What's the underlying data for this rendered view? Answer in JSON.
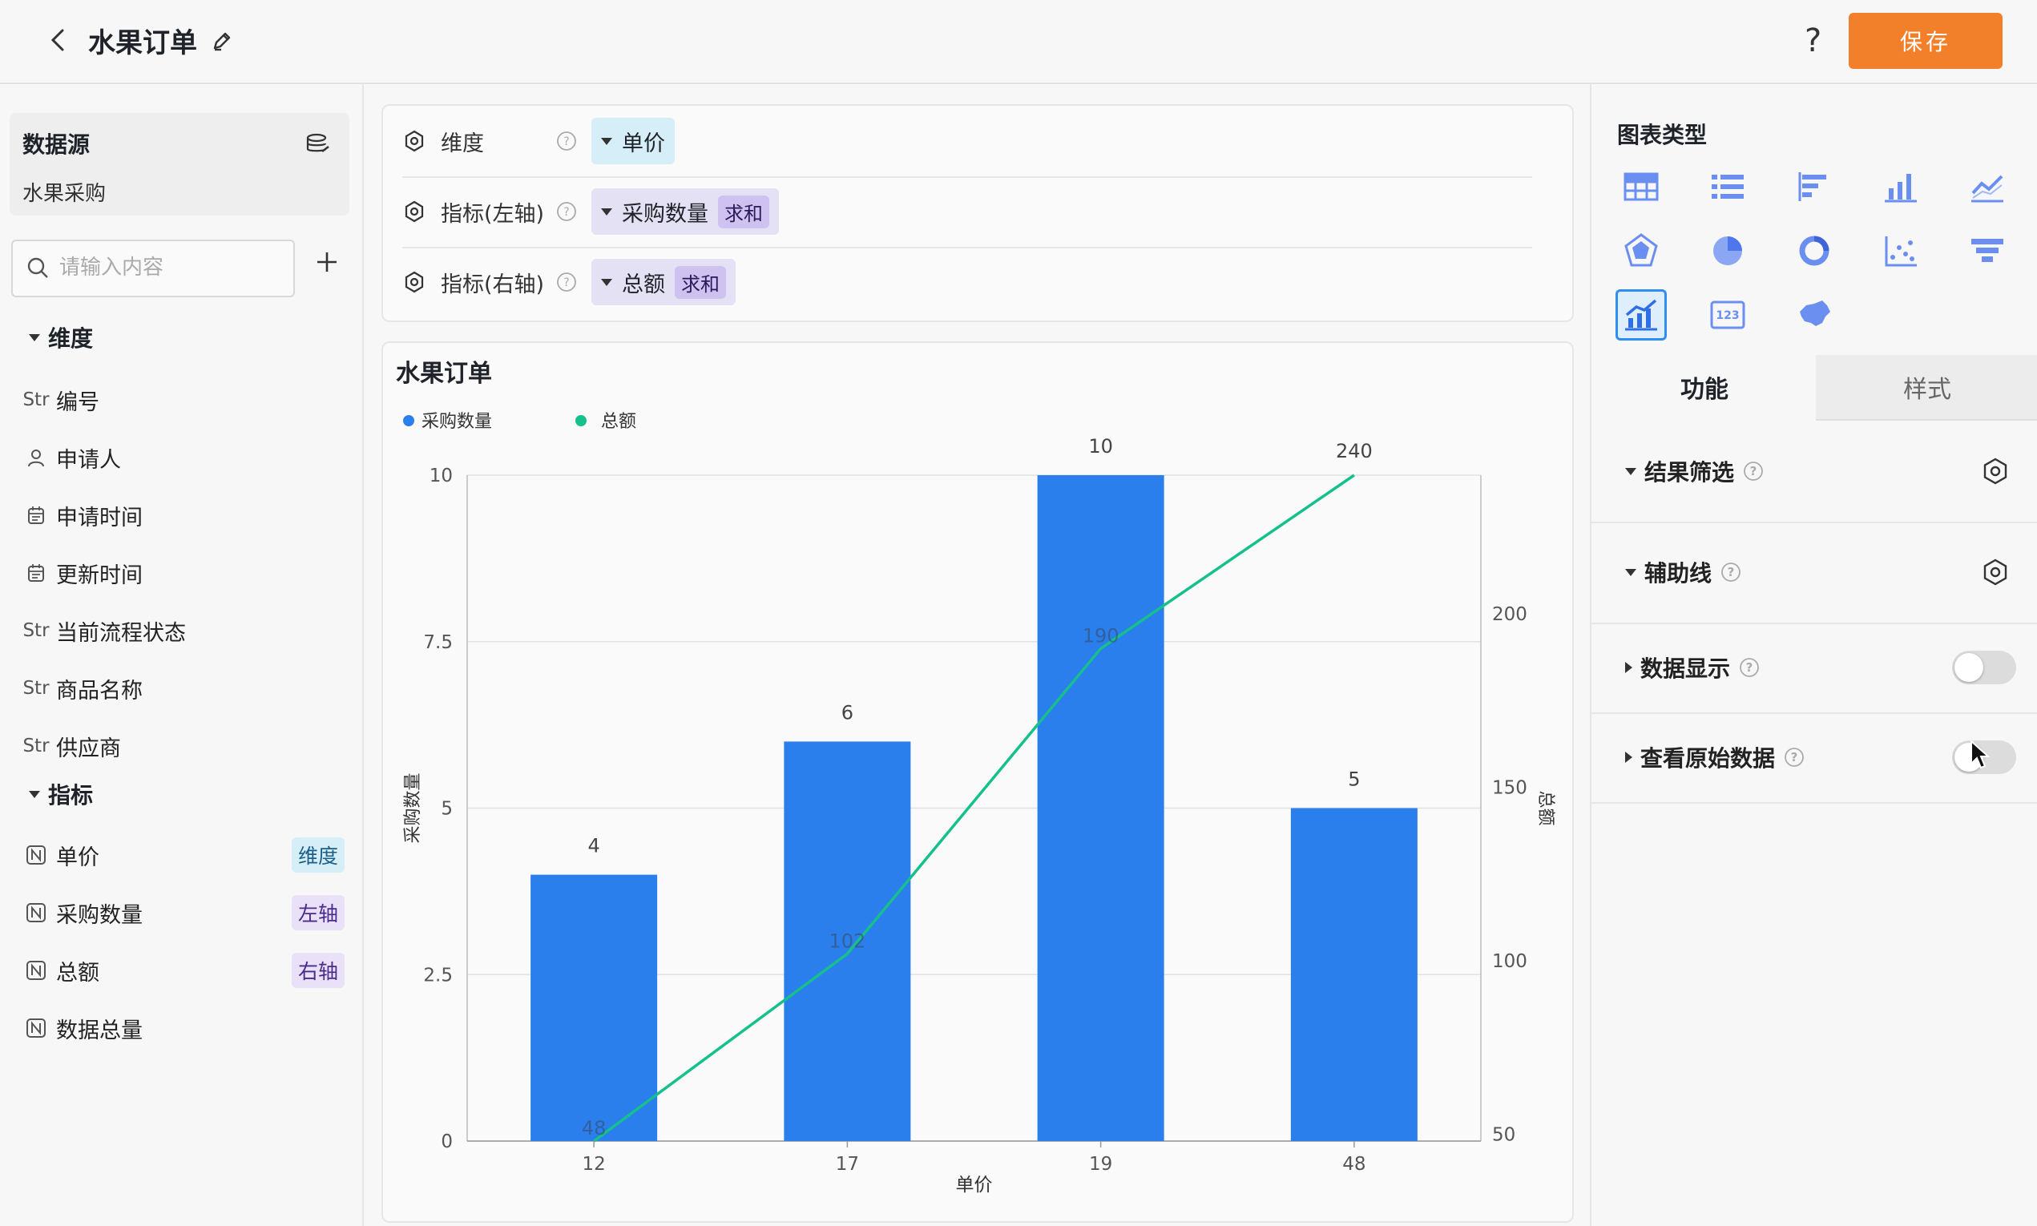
{
  "header": {
    "title": "水果订单",
    "help": "?",
    "save_label": "保存"
  },
  "datasource": {
    "label": "数据源",
    "name": "水果采购"
  },
  "search": {
    "placeholder": "请输入内容"
  },
  "dimensions": {
    "label": "维度",
    "fields": [
      {
        "type": "Str",
        "name": "编号"
      },
      {
        "type": "person",
        "name": "申请人"
      },
      {
        "type": "date",
        "name": "申请时间"
      },
      {
        "type": "date",
        "name": "更新时间"
      },
      {
        "type": "Str",
        "name": "当前流程状态"
      },
      {
        "type": "Str",
        "name": "商品名称"
      },
      {
        "type": "Str",
        "name": "供应商"
      }
    ]
  },
  "metrics": {
    "label": "指标",
    "fields": [
      {
        "type": "N",
        "name": "单价",
        "tag": "维度"
      },
      {
        "type": "N",
        "name": "采购数量",
        "tag": "左轴"
      },
      {
        "type": "N",
        "name": "总额",
        "tag": "右轴"
      },
      {
        "type": "N",
        "name": "数据总量",
        "tag": ""
      }
    ]
  },
  "config": {
    "dimension": {
      "label": "维度",
      "value": "单价"
    },
    "left_axis": {
      "label": "指标(左轴)",
      "value": "采购数量",
      "agg": "求和"
    },
    "right_axis": {
      "label": "指标(右轴)",
      "value": "总额",
      "agg": "求和"
    }
  },
  "chart_data": {
    "type": "bar",
    "title": "水果订单",
    "categories": [
      "12",
      "17",
      "19",
      "48"
    ],
    "xlabel": "单价",
    "series": [
      {
        "name": "采购数量",
        "type": "bar",
        "axis": "left",
        "values": [
          4,
          6,
          10,
          5
        ],
        "labels": [
          "4",
          "6",
          "10",
          "5"
        ],
        "color": "#2b7fec"
      },
      {
        "name": "总额",
        "type": "line",
        "axis": "right",
        "values": [
          48,
          102,
          190,
          240
        ],
        "labels": [
          "48",
          "102",
          "190",
          "240"
        ],
        "color": "#16c08c"
      }
    ],
    "y_left": {
      "label": "采购数量",
      "ylim": [
        0,
        10
      ],
      "ticks": [
        "0",
        "2.5",
        "5",
        "7.5",
        "10"
      ]
    },
    "y_right": {
      "label": "总额",
      "ylim": [
        48,
        240
      ],
      "ticks": [
        "50",
        "100",
        "150",
        "200"
      ]
    },
    "legend": "top-left",
    "grid": true
  },
  "chart_types": {
    "label": "图表类型",
    "items": [
      "table-icon",
      "list-icon",
      "bar-horizontal-icon",
      "bar-column-icon",
      "line-chart-icon",
      "radar-icon",
      "pie-icon",
      "donut-icon",
      "scatter-icon",
      "funnel-icon",
      "combo-chart-icon",
      "number-card-icon",
      "map-icon"
    ],
    "selected": "combo-chart-icon"
  },
  "tabs": {
    "function": "功能",
    "style": "样式"
  },
  "sections": [
    {
      "label": "结果筛选",
      "kind": "settings"
    },
    {
      "label": "辅助线",
      "kind": "settings"
    },
    {
      "label": "数据显示",
      "kind": "toggle",
      "on": false
    },
    {
      "label": "查看原始数据",
      "kind": "toggle",
      "on": false
    }
  ],
  "colors": {
    "accent": "#f2802a",
    "bar": "#2b7fec",
    "line": "#16c08c",
    "selected": "#2e8ff0"
  }
}
